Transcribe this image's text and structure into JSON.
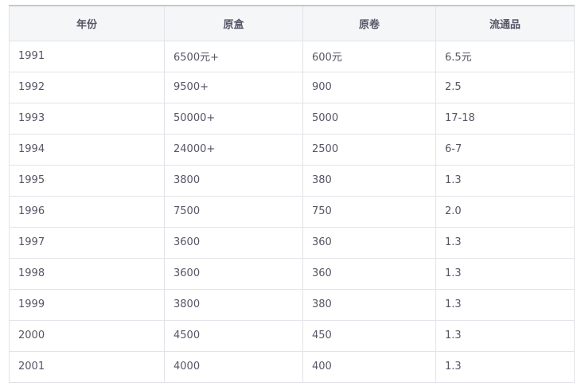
{
  "table": {
    "headers": [
      "年份",
      "原盒",
      "原卷",
      "流通品"
    ],
    "rows": [
      [
        "1991",
        "6500元+",
        "600元",
        "6.5元"
      ],
      [
        "1992",
        "9500+",
        "900",
        "2.5"
      ],
      [
        "1993",
        "50000+",
        "5000",
        "17-18"
      ],
      [
        "1994",
        "24000+",
        "2500",
        "6-7"
      ],
      [
        "1995",
        "3800",
        "380",
        "1.3"
      ],
      [
        "1996",
        "7500",
        "750",
        "2.0"
      ],
      [
        "1997",
        "3600",
        "360",
        "1.3"
      ],
      [
        "1998",
        "3600",
        "360",
        "1.3"
      ],
      [
        "1999",
        "3800",
        "380",
        "1.3"
      ],
      [
        "2000",
        "4500",
        "450",
        "1.3"
      ],
      [
        "2001",
        "4000",
        "400",
        "1.3"
      ]
    ]
  }
}
